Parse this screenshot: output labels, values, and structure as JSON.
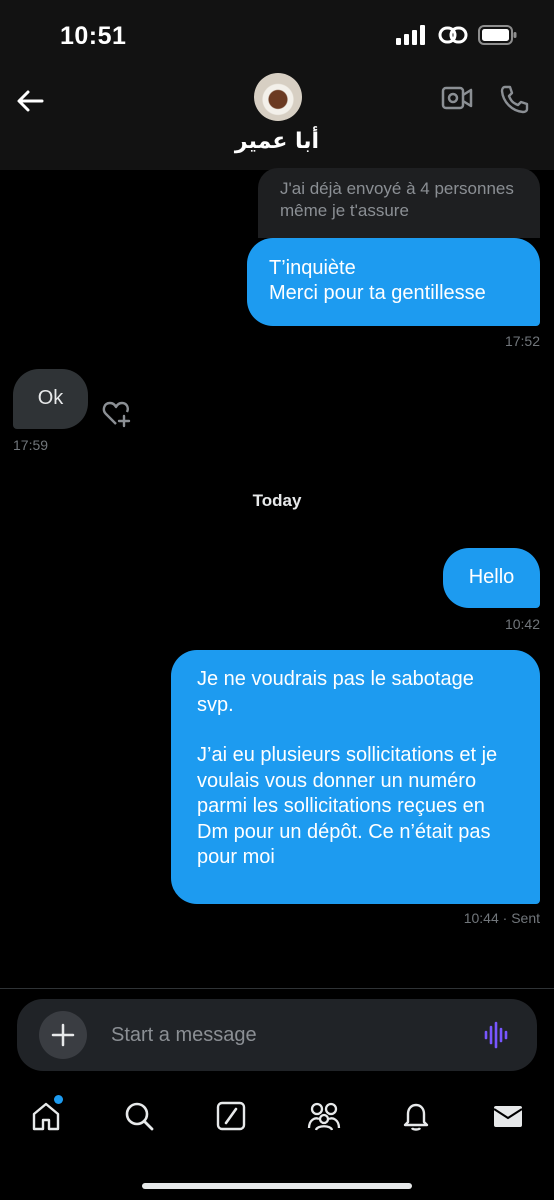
{
  "status_bar": {
    "time": "10:51"
  },
  "header": {
    "contact_name": "أبا عمير",
    "back_icon": "arrow-left-icon",
    "video_icon": "video-call-icon",
    "phone_icon": "phone-call-icon"
  },
  "messages": {
    "quoted_text": "J'ai déjà envoyé à 4 personnes même je t'assure",
    "m1": {
      "line1": "T’inquiète",
      "line2": "Merci pour ta gentillesse",
      "time": "17:52"
    },
    "m2": {
      "text": "Ok",
      "time": "17:59"
    },
    "day_separator": "Today",
    "m3": {
      "text": "Hello",
      "time": "10:42"
    },
    "m4": {
      "para1": "Je ne voudrais pas le sabotage svp.",
      "para2": "J’ai eu plusieurs sollicitations et je voulais vous donner un numéro parmi les sollicitations reçues en Dm pour un dépôt. Ce n’était pas pour moi",
      "time": "10:44 · Sent"
    }
  },
  "composer": {
    "placeholder": "Start a message"
  },
  "nav": [
    "home-icon",
    "search-icon",
    "grok-icon",
    "communities-icon",
    "notifications-icon",
    "messages-icon"
  ],
  "colors": {
    "accent": "#1d9bf0",
    "incoming": "#2f3336",
    "background": "#000000",
    "voice": "#7856ff"
  }
}
